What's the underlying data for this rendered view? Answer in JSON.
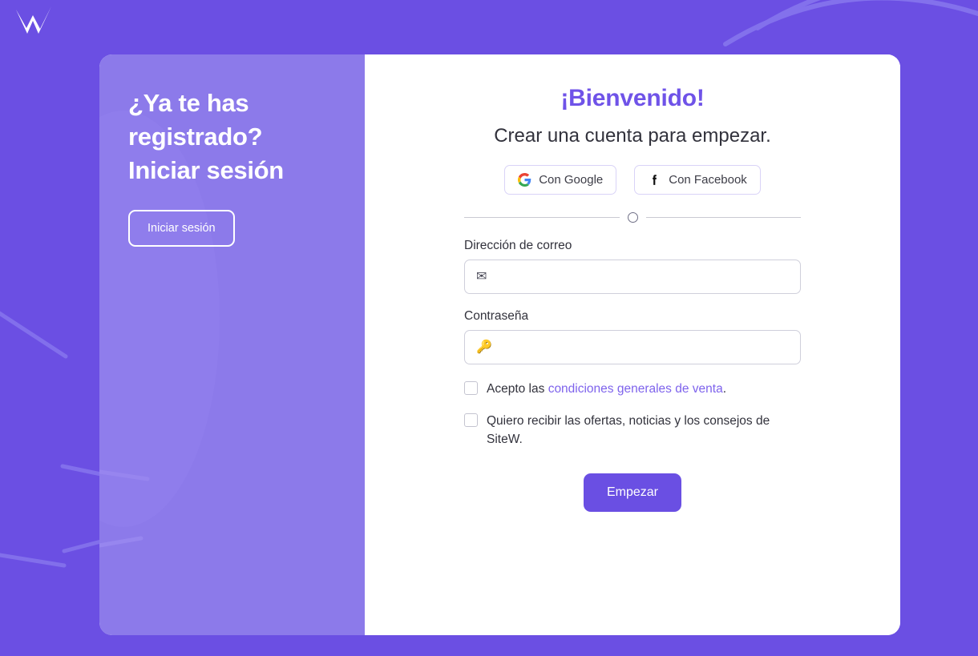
{
  "brand": {
    "logo_icon": "sitew-w-logo-icon",
    "accent_color": "#6a4fe3",
    "panel_color": "#8c7aea",
    "background_color": "#6b4fe3"
  },
  "left_panel": {
    "heading": "¿Ya te has registrado? Iniciar sesión",
    "login_button": "Iniciar sesión"
  },
  "right_panel": {
    "title": "¡Bienvenido!",
    "subtitle": "Crear una cuenta para empezar.",
    "social": [
      {
        "label": "Con Google",
        "icon": "google-icon"
      },
      {
        "label": "Con Facebook",
        "icon": "facebook-icon"
      }
    ],
    "divider_symbol": "O",
    "fields": [
      {
        "label": "Dirección de correo",
        "value": "",
        "placeholder": "✉",
        "icon": "envelope-icon"
      },
      {
        "label": "Contraseña",
        "value": "",
        "placeholder": "🔑",
        "icon": "key-icon"
      }
    ],
    "checkboxes": [
      {
        "text_before": "Acepto las ",
        "link_text": "condiciones generales de venta",
        "text_after": ".",
        "checked": false
      },
      {
        "text_before": "Quiero recibir las ofertas, noticias y los consejos de SiteW.",
        "link_text": "",
        "text_after": "",
        "checked": false
      }
    ],
    "submit_button": "Empezar"
  }
}
